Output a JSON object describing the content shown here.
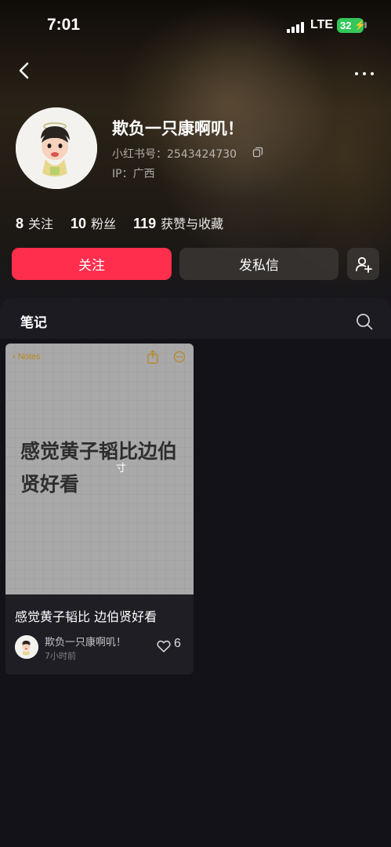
{
  "status_bar": {
    "time": "7:01",
    "network": "LTE",
    "battery": "32"
  },
  "profile": {
    "nickname": "欺负一只康啊叽！",
    "redbook_id": "小红书号：2543424730",
    "ip": "IP：广西",
    "avatar_icon": "boy-cartoon-avatar"
  },
  "stats": [
    {
      "num": "8",
      "label": "关注"
    },
    {
      "num": "10",
      "label": "粉丝"
    },
    {
      "num": "119",
      "label": "获赞与收藏"
    }
  ],
  "actions": {
    "follow": "关注",
    "message": "发私信",
    "add_friend_icon": "add-person-icon"
  },
  "tabs": {
    "notes": "笔记",
    "search_icon": "search-icon"
  },
  "note": {
    "cover": {
      "back": "Notes",
      "text": "感觉黄子韬比边伯贤好看",
      "cursor": "寸"
    },
    "title": "感觉黄子韬比 边伯贤好看",
    "author": "欺负一只康啊叽！",
    "time": "7小时前",
    "likes": "6"
  },
  "colors": {
    "accent": "#ff2e4d",
    "background": "#17161c",
    "cover": "#a9a9a9",
    "notes_yellow": "#b8871c"
  }
}
